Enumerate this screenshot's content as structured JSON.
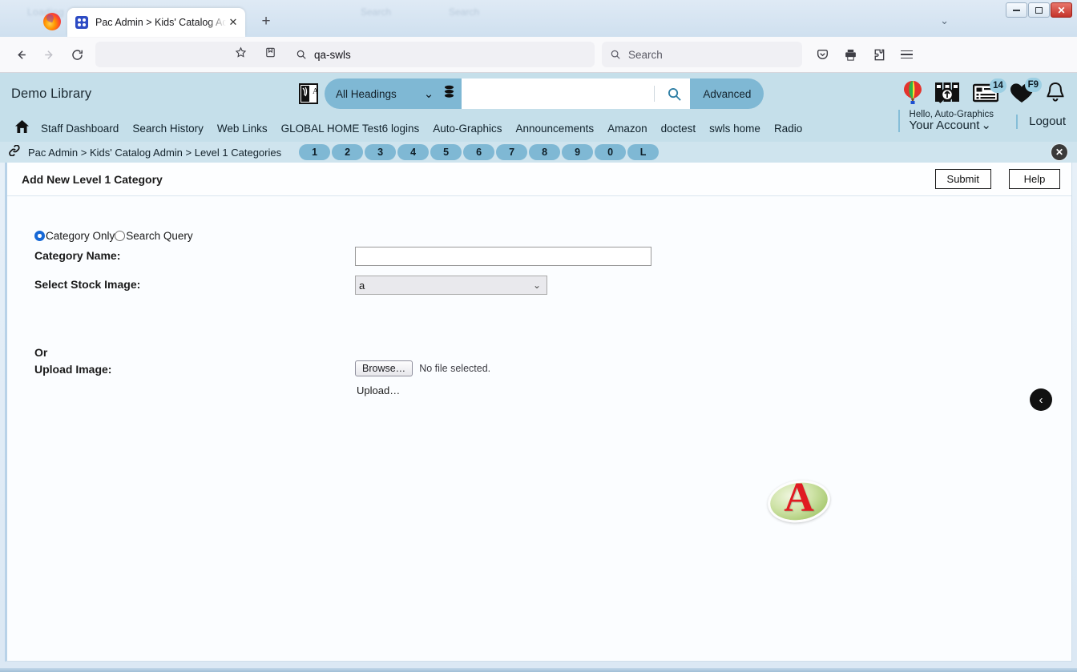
{
  "browser": {
    "tab_title": "Pac Admin > Kids' Catalog Adm",
    "tab_close_glyph": "✕",
    "new_tab_glyph": "+",
    "url_value": "qa-swls",
    "search_placeholder": "Search",
    "back_glyph": "←",
    "forward_glyph": "→",
    "reload_glyph": "⟳",
    "window_controls": {
      "minimize": "–",
      "maximize": "❐",
      "close": "✕"
    },
    "titlebar_chevron": "⌄",
    "ghost_labels": {
      "left": "Loading",
      "mid": "Search",
      "right": "Search"
    }
  },
  "app_header": {
    "library_name": "Demo Library",
    "lang_icon_name": "translate-icon",
    "headings_select": "All Headings",
    "headings_chevron": "⌄",
    "database_icon_name": "database-icon",
    "search_value": "",
    "search_go_icon": "search-icon",
    "advanced_label": "Advanced",
    "icons": [
      {
        "name": "balloon-icon",
        "badge": ""
      },
      {
        "name": "book-search-icon",
        "badge": ""
      },
      {
        "name": "list-card-icon",
        "badge": "14"
      },
      {
        "name": "heart-icon",
        "badge": "F9"
      },
      {
        "name": "bell-icon",
        "badge": ""
      }
    ],
    "account": {
      "hello": "Hello, Auto-Graphics",
      "name": "Your Account",
      "chevron": "⌄"
    },
    "logout_label": "Logout",
    "home_icon_name": "home-icon",
    "nav_links": [
      "Staff Dashboard",
      "Search History",
      "Web Links",
      "GLOBAL HOME Test6 logins",
      "Auto-Graphics",
      "Announcements",
      "Amazon",
      "doctest",
      "swls home",
      "Radio"
    ]
  },
  "breadcrumb": {
    "chain_icon_name": "link-icon",
    "path": "Pac Admin > Kids' Catalog Admin > Level 1 Categories",
    "pills": [
      "1",
      "2",
      "3",
      "4",
      "5",
      "6",
      "7",
      "8",
      "9",
      "0",
      "L"
    ],
    "close_glyph": "✕"
  },
  "panel": {
    "title": "Add New Level 1 Category",
    "submit_label": "Submit",
    "help_label": "Help"
  },
  "form": {
    "radio_category_only": "Category Only",
    "radio_search_query": "Search Query",
    "selected_radio": "Category Only",
    "category_name_label": "Category Name:",
    "category_name_value": "",
    "stock_image_label": "Select Stock Image:",
    "stock_image_value": "a",
    "stock_image_chevron": "⌄",
    "stock_preview_letter": "A",
    "or_label": "Or",
    "upload_image_label": "Upload Image:",
    "browse_label": "Browse…",
    "no_file_text": "No file selected.",
    "upload_link_label": "Upload…",
    "back_glyph": "‹"
  },
  "colors": {
    "header_bg": "#c5dfea",
    "pill_bg": "#7fb8d4",
    "crumb_bg": "#cfe4ee",
    "panel_bg": "#fbfdff",
    "radio_accent": "#1668d6",
    "stock_letter": "#e01b22",
    "close_btn": "#c4332a"
  }
}
